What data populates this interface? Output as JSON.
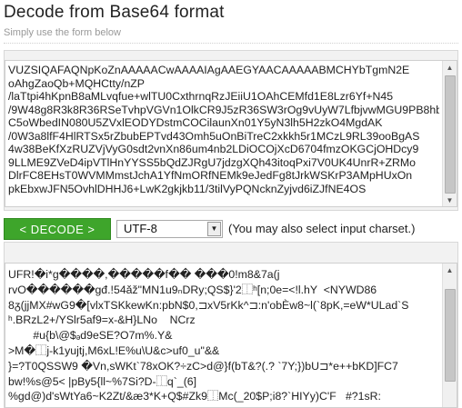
{
  "header": {
    "title": "Decode from Base64 format",
    "subtitle": "Simply use the form below"
  },
  "input": {
    "lines": [
      "VUZSIQAFAQNpKoZnAAAAACwAAAAIAgAAEGYAACAAAAABMCHYbTgmN2E",
      "oAhgZaoQb+MQHCtty/nZP",
      "/laTtpi4hKpnB8aMLvqfue+wlTU0CxthrnqRzJEiiU1OAhCEMfd1E8Lzr6Yf+N45",
      "/9W48g8R3k8R36RSeTvhpVGVn1OlkCR9J5zR36SW3rOg9vUyW7LfbjvwMGU9PB8hb",
      "C5oWbedIN080U5ZVxlEODYDstmCOCilaunXn01Y5yN3lh5H2zkO4MgdAK",
      "/0W3a8lfF4HlRTSx5rZbubEPTvd43Omh5uOnBiTreC2xkkh5r1MCzL9RL39ooBgAS",
      "4w38BeKfXzRUZVjVyG0sdt2vnXn86um4nb2LDiOCOjXcD6704fmzOKGCjOHDcy9",
      "9LLME9ZVeD4ipVTlHnYYSS5bQdZJRgU7jdzgXQh43itoqPxi7V0UK4UnrR+ZRMo",
      "DlrFC8EHsT0WVMMmstJchA1YfNmORfNEMk9eJedFg8tJrkWSKrP3AMpHUxOn",
      "pkEbxwJFN5OvhlDHHJ6+LwK2gkjkb11/3tilVyPQNcknZyjvd6iZJfNE4OS"
    ]
  },
  "controls": {
    "decode_label": "< DECODE >",
    "charset_value": "UTF-8",
    "hint": "(You may also select input charset.)"
  },
  "output": {
    "lines": [
      "UFR!�i*g����,�����f�� ���0!m8&7a(j",
      "rvO������gđ.!54ǎž\"MN1u9ₙDRy;QS$}'2⿰ʰ[n;0e=<!l.hY  <NYWD86",
      "8ᵹ(jjMX#wG9�[vlxTSKkewKn:pbN$0,⊐xV5rKk^⊐:n'obÈw8~l(`8pK,=eW*ULad`S",
      "ʰ.BRzL2+/YSlr5af9=x-&H}LNo    NCrz",
      "        #u{b\\@$ₔd9eSE?O7m%.Y&",
      ">M�⿰j-k1yujtj,M6xL!E%u\\U&c>uf0_u\"&&",
      "}=?T0QSSW9 �Vn,sWKt`78xOK?÷zC>d@}f(bT&?(.? `7Y;})bU⊐*e++bKD]FC7",
      "bw!%s@5< |pBy5{ll~%7Si?D-⿰q`_(6]",
      "%gd@)d'sWtYa6~K2Zt/&æ3*K+Q$#Zk9⿰Mc(_20$P;i8?`HIYy)C'F   #?1sR:"
    ]
  },
  "colors": {
    "button": "#3ea52b",
    "panel": "#f2f2f2"
  }
}
